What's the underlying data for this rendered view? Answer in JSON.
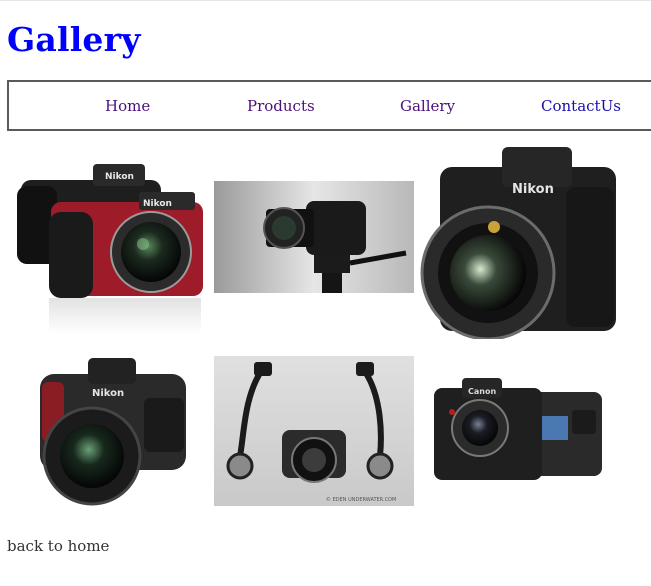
{
  "page": {
    "title": "Gallery"
  },
  "nav": {
    "items": [
      {
        "label": "Home"
      },
      {
        "label": "Products"
      },
      {
        "label": "Gallery"
      },
      {
        "label": "ContactUs"
      }
    ]
  },
  "gallery": {
    "photos": [
      {
        "label": "Nikon",
        "label2": "Nikon",
        "subject": "two-compact-cameras-black-red"
      },
      {
        "subject": "dslr-on-tripod-grey-background"
      },
      {
        "label": "Nikon",
        "subject": "pro-dslr-front-view"
      },
      {
        "label": "Nikon",
        "subject": "dslr-with-zoom-lens"
      },
      {
        "caption": "© EDEN UNDERWATER.COM",
        "subject": "underwater-housing-with-strobes"
      },
      {
        "label": "Canon",
        "subject": "canon-dslr-front-and-back"
      }
    ]
  },
  "footer": {
    "back_link": "back to home"
  },
  "colors": {
    "title": "#0000ff",
    "nav_visited": "#4b0f7a",
    "nav_link": "#1a0fa8",
    "camera_red": "#9e1b2a",
    "camera_black": "#1c1c1c"
  }
}
